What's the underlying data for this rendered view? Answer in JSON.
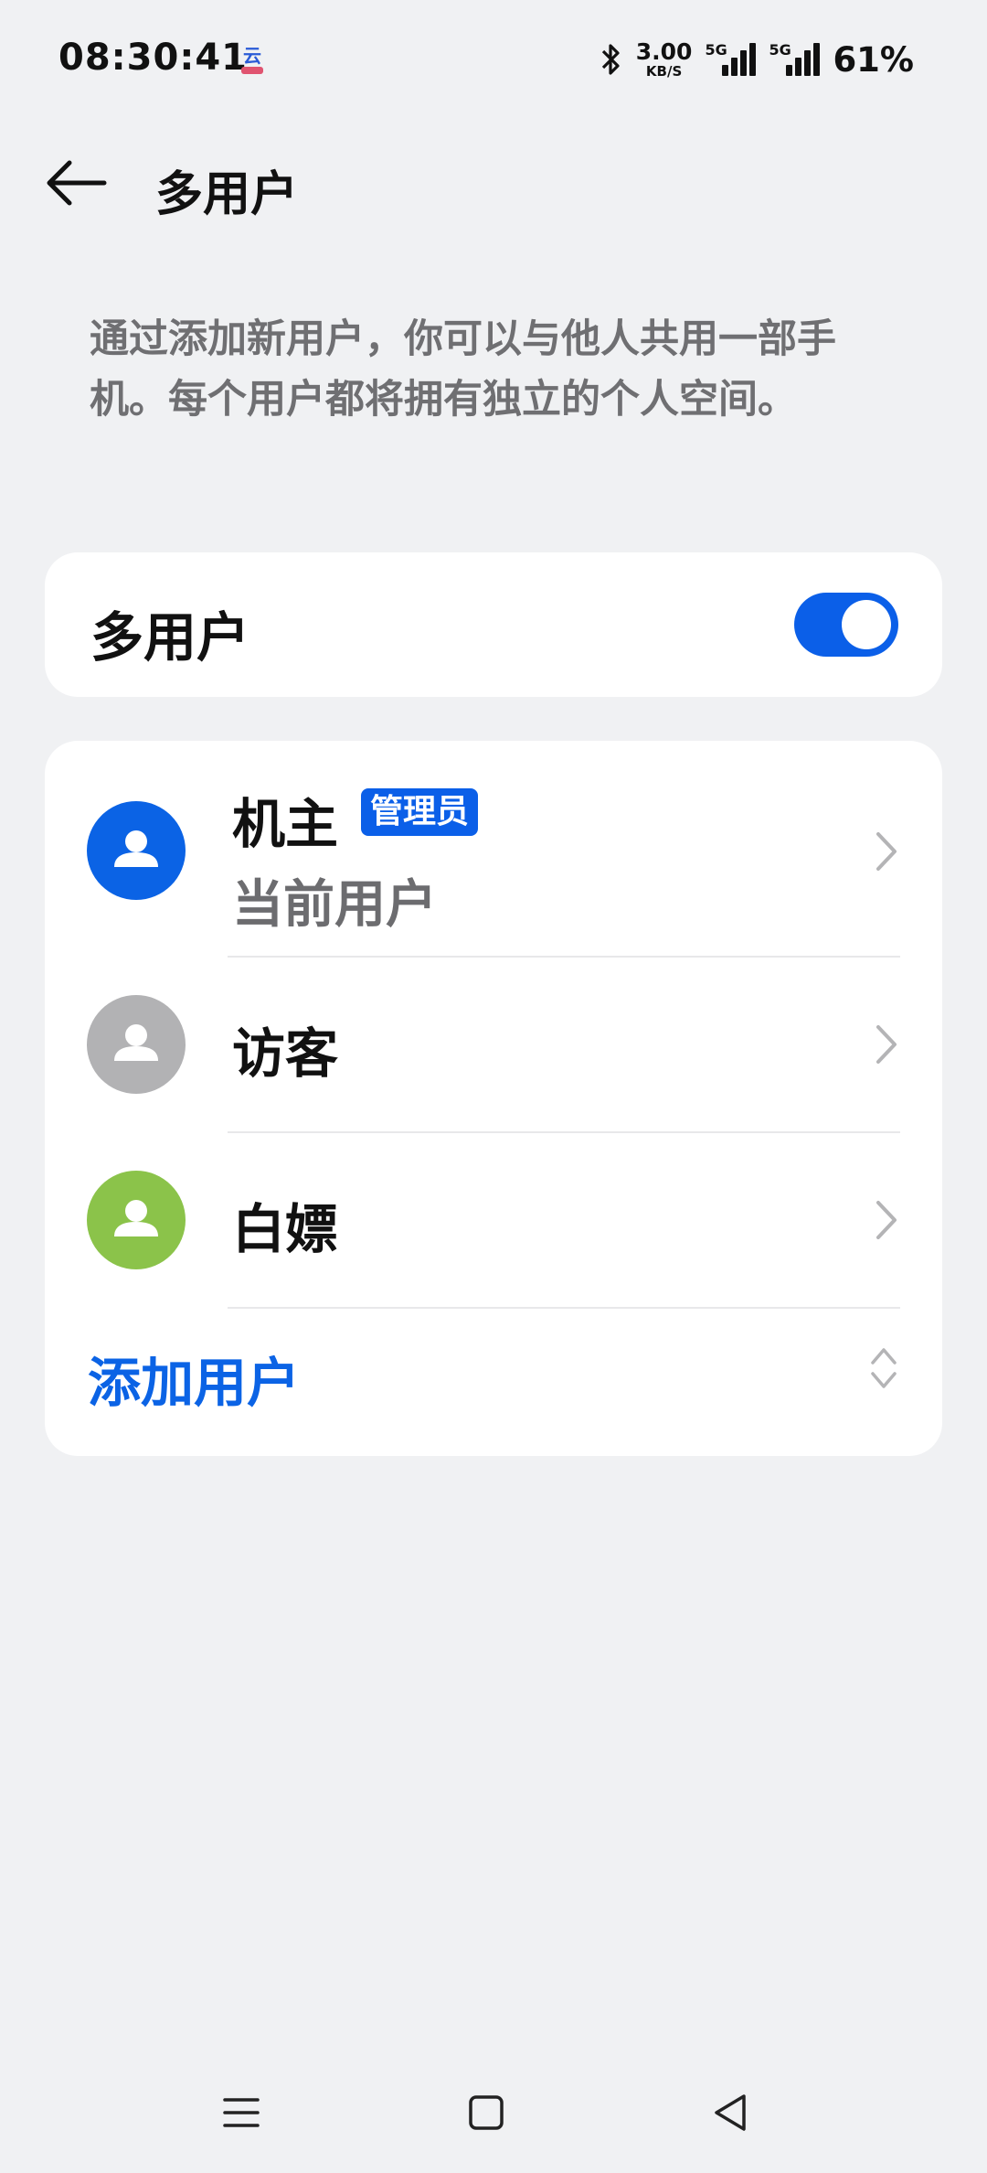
{
  "status_bar": {
    "time": "08:30:41",
    "app_icon": "cloud-app-icon",
    "bluetooth_icon": "bluetooth-icon",
    "net_speed_value": "3.00",
    "net_speed_unit": "KB/S",
    "sim1_label": "5G",
    "sim2_label": "5G",
    "battery": "61%"
  },
  "header": {
    "back_icon": "back-arrow-icon",
    "title": "多用户"
  },
  "description": "通过添加新用户，你可以与他人共用一部手机。每个用户都将拥有独立的个人空间。",
  "multi_user_toggle": {
    "label": "多用户",
    "state": "on",
    "accent_color": "#0b5fe8"
  },
  "users": [
    {
      "name": "机主",
      "badge": "管理员",
      "subtitle": "当前用户",
      "avatar_color": "#0b63e5",
      "icon": "person-icon"
    },
    {
      "name": "访客",
      "avatar_color": "#b2b2b4",
      "icon": "person-icon"
    },
    {
      "name": "白嫖",
      "avatar_color": "#8bc34a",
      "icon": "person-icon"
    }
  ],
  "add_user": {
    "label": "添加用户",
    "icon": "expand-collapse-icon",
    "color": "#0b63e5"
  },
  "nav_bar": {
    "menu_icon": "recents-menu-icon",
    "home_icon": "home-square-icon",
    "back_icon": "back-triangle-icon"
  }
}
